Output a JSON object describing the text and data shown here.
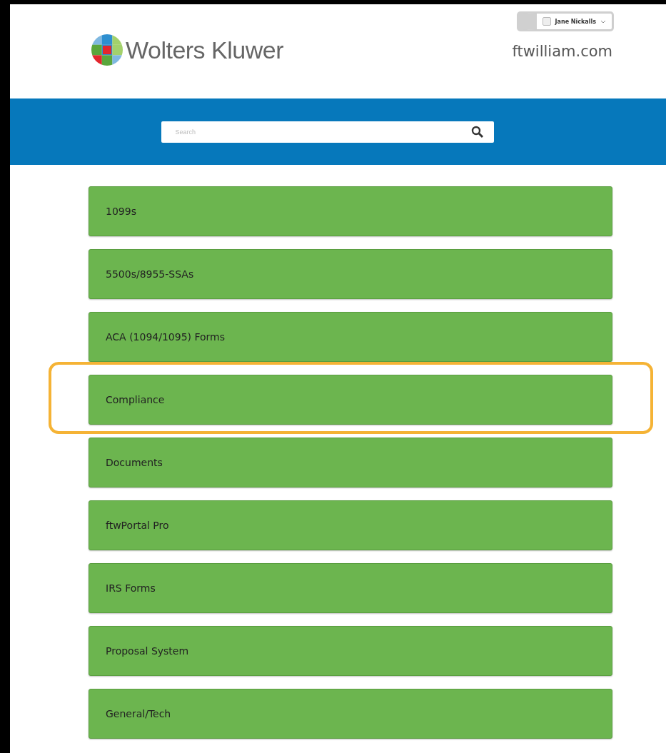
{
  "header": {
    "logo_text": "Wolters Kluwer",
    "site_name": "ftwilliam.com",
    "user_menu": {
      "label": "Jane Nickalls"
    }
  },
  "search": {
    "placeholder": "Search"
  },
  "products": [
    {
      "label": "1099s",
      "highlighted": false
    },
    {
      "label": "5500s/8955-SSAs",
      "highlighted": false
    },
    {
      "label": "ACA (1094/1095) Forms",
      "highlighted": false
    },
    {
      "label": "Compliance",
      "highlighted": true
    },
    {
      "label": "Documents",
      "highlighted": false
    },
    {
      "label": "ftwPortal Pro",
      "highlighted": false
    },
    {
      "label": "IRS Forms",
      "highlighted": false
    },
    {
      "label": "Proposal System",
      "highlighted": false
    },
    {
      "label": "General/Tech",
      "highlighted": false
    }
  ]
}
